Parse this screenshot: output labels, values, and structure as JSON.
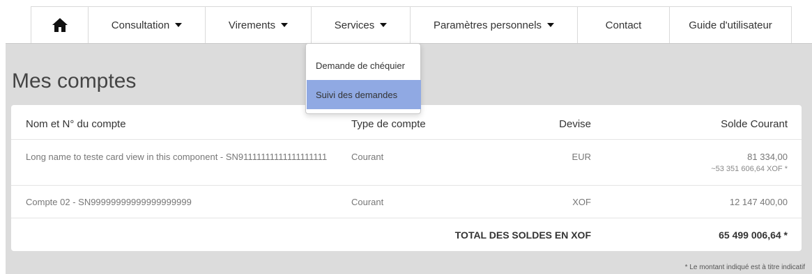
{
  "nav": {
    "home_icon": "home-icon",
    "items": [
      {
        "label": "Consultation",
        "has_caret": true
      },
      {
        "label": "Virements",
        "has_caret": true
      },
      {
        "label": "Services",
        "has_caret": true
      },
      {
        "label": "Paramètres personnels",
        "has_caret": true
      },
      {
        "label": "Contact",
        "has_caret": false
      },
      {
        "label": "Guide d'utilisateur",
        "has_caret": false
      }
    ]
  },
  "dropdown": {
    "items": [
      {
        "label": "Demande de chéquier",
        "active": false
      },
      {
        "label": "Suivi des demandes",
        "active": true
      }
    ],
    "active_color": "#90a9e3"
  },
  "page": {
    "title": "Mes comptes"
  },
  "table": {
    "headers": {
      "name": "Nom et N° du compte",
      "type": "Type de compte",
      "currency": "Devise",
      "balance": "Solde Courant"
    },
    "rows": [
      {
        "name": "Long name to teste card view in this component - SN91111111111111111111",
        "type": "Courant",
        "currency": "EUR",
        "balance": "81 334,00",
        "converted": "~53 351 606,64 XOF *"
      },
      {
        "name": "Compte 02 - SN99999999999999999999",
        "type": "Courant",
        "currency": "XOF",
        "balance": "12 147 400,00"
      }
    ],
    "total_label": "TOTAL DES SOLDES EN XOF",
    "total_value": "65 499 006,64 *"
  },
  "footnote": "* Le montant indiqué est à titre indicatif",
  "colors": {
    "background_gray": "#dcdcdc"
  }
}
